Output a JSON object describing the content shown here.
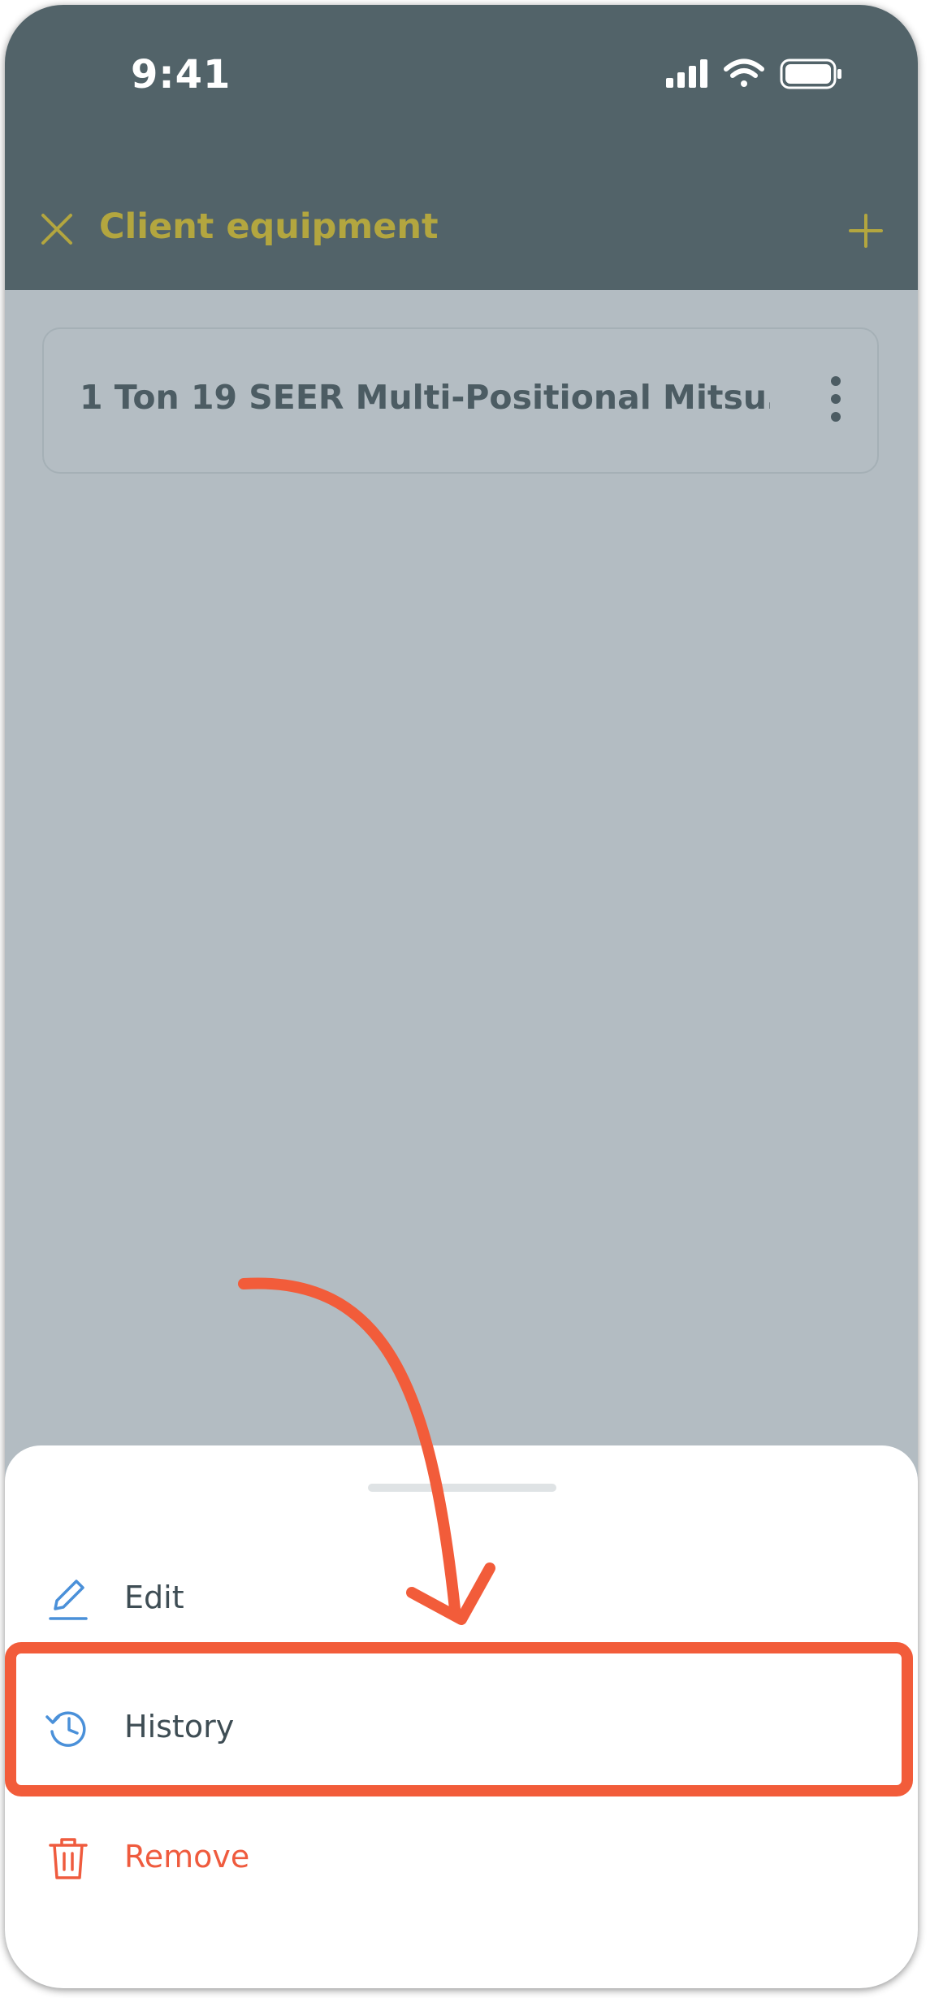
{
  "status_bar": {
    "time": "9:41",
    "icons": [
      "cellular-signal-icon",
      "wifi-icon",
      "battery-icon"
    ]
  },
  "header": {
    "title": "Client equipment",
    "left_icon": "close-icon",
    "right_icon": "plus-icon",
    "background": "#526369",
    "title_color": "#b3a63f"
  },
  "equipment_list": [
    {
      "name": "1 Ton 19 SEER Multi-Positional Mitsu…",
      "menu_icon": "more-vertical-icon"
    }
  ],
  "action_sheet": {
    "items": [
      {
        "label": "Edit",
        "icon": "pencil-icon"
      },
      {
        "label": "History",
        "icon": "history-icon",
        "highlighted": true
      },
      {
        "label": "Remove",
        "icon": "trash-icon",
        "color": "#ef5b3e"
      }
    ]
  },
  "annotation": {
    "arrow_color": "#f25c3a",
    "highlight_color": "#f25c3a"
  }
}
